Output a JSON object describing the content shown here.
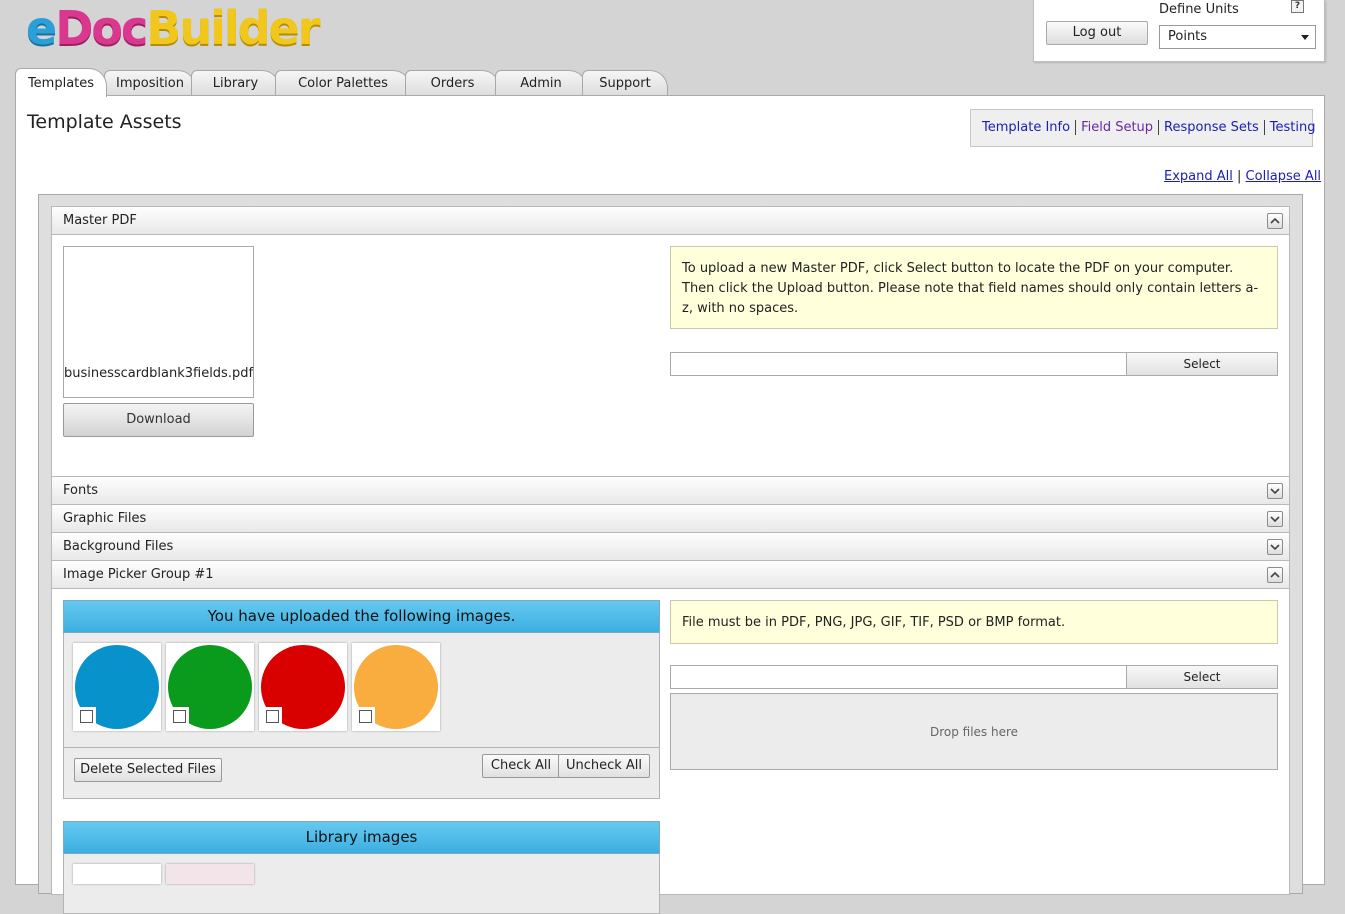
{
  "app": {
    "logo": {
      "part1": "e",
      "part2": "Doc",
      "part3": "Builder"
    }
  },
  "user_box": {
    "logout_label": "Log out",
    "units_label": "Define Units",
    "help_glyph": "?",
    "units_value": "Points"
  },
  "tabs": [
    {
      "label": "Templates",
      "active": true
    },
    {
      "label": "Imposition"
    },
    {
      "label": "Library"
    },
    {
      "label": "Color Palettes"
    },
    {
      "label": "Orders"
    },
    {
      "label": "Admin"
    },
    {
      "label": "Support"
    }
  ],
  "page": {
    "title": "Template Assets",
    "subnav": [
      "Template Info",
      "Field Setup",
      "Response Sets",
      "Testing"
    ],
    "expand_all": "Expand All",
    "separator": "|",
    "collapse_all": "Collapse All"
  },
  "sections": {
    "master_pdf": "Master PDF",
    "fonts": "Fonts",
    "graphic_files": "Graphic Files",
    "background_files": "Background Files",
    "image_picker": "Image Picker Group #1"
  },
  "master_pdf": {
    "file_name": "businesscardblank3fields.pdf",
    "download_label": "Download",
    "notice": "To upload a new Master PDF, click Select button to locate the PDF on your computer. Then click the Upload button. Please note that field names should only contain letters a-z, with no spaces.",
    "select_label": "Select"
  },
  "image_picker": {
    "uploaded_header": "You have uploaded the following images.",
    "images": [
      {
        "name": "blue-circle",
        "color": "#0892cc"
      },
      {
        "name": "green-circle",
        "color": "#0a9a1c"
      },
      {
        "name": "red-circle",
        "color": "#d90000"
      },
      {
        "name": "orange-circle",
        "color": "#f9ad3e"
      }
    ],
    "delete_label": "Delete Selected Files",
    "check_all_label": "Check All",
    "uncheck_all_label": "Uncheck All",
    "format_notice": "File must be in PDF, PNG, JPG, GIF, TIF, PSD or BMP format.",
    "select_label": "Select",
    "drop_label": "Drop files here",
    "library_header": "Library images"
  }
}
